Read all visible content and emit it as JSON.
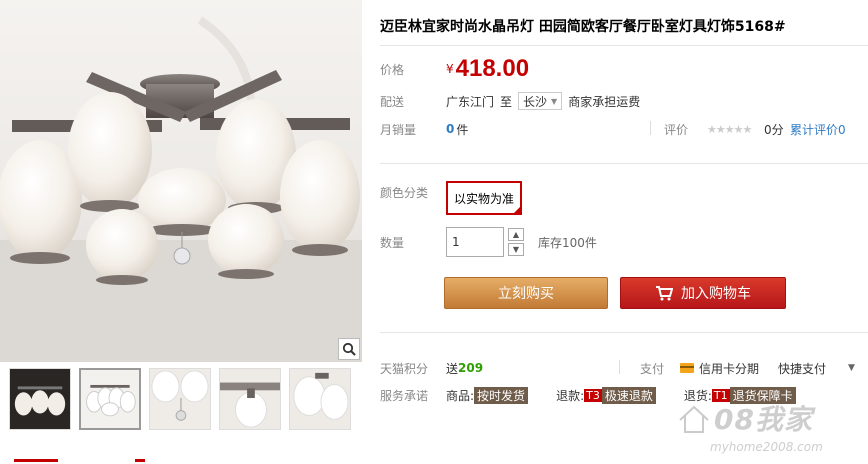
{
  "product": {
    "title": "迈臣林宜家时尚水晶吊灯 田园简欧客厅餐厅卧室灯具灯饰5168#"
  },
  "price": {
    "label": "价格",
    "currency": "¥",
    "value": "418.00"
  },
  "shipping": {
    "label": "配送",
    "origin": "广东江门",
    "to_word": "至",
    "destination": "长沙",
    "note": "商家承担运费"
  },
  "sales": {
    "label": "月销量",
    "count": "0",
    "unit": "件",
    "rating_label": "评价",
    "stars": "★★★★★",
    "score": "0分",
    "total_reviews_link": "累计评价0"
  },
  "color": {
    "label": "颜色分类",
    "option": "以实物为准"
  },
  "quantity": {
    "label": "数量",
    "value": "1",
    "stock": "库存100件"
  },
  "actions": {
    "buy_now": "立刻购买",
    "add_to_cart": "加入购物车"
  },
  "points": {
    "label": "天猫积分",
    "prefix": "送",
    "value": "209"
  },
  "payment": {
    "label": "支付",
    "credit": "信用卡分期",
    "quick": "快捷支付"
  },
  "service": {
    "label": "服务承诺",
    "goods_prefix": "商品:",
    "goods_tag": "按时发货",
    "refund_prefix": "退款:",
    "refund_badge": "T3",
    "refund_tag": "极速退款",
    "return_prefix": "退货:",
    "return_badge": "T1",
    "return_tag": "退货保障卡"
  },
  "watermark": {
    "brand": "08我家",
    "url": "myhome2008.com"
  },
  "icons": {
    "zoom": "magnifier-icon",
    "cart": "cart-icon",
    "card": "credit-card-icon",
    "caret": "caret-down-icon",
    "up": "arrow-up-icon",
    "down": "arrow-down-icon"
  }
}
